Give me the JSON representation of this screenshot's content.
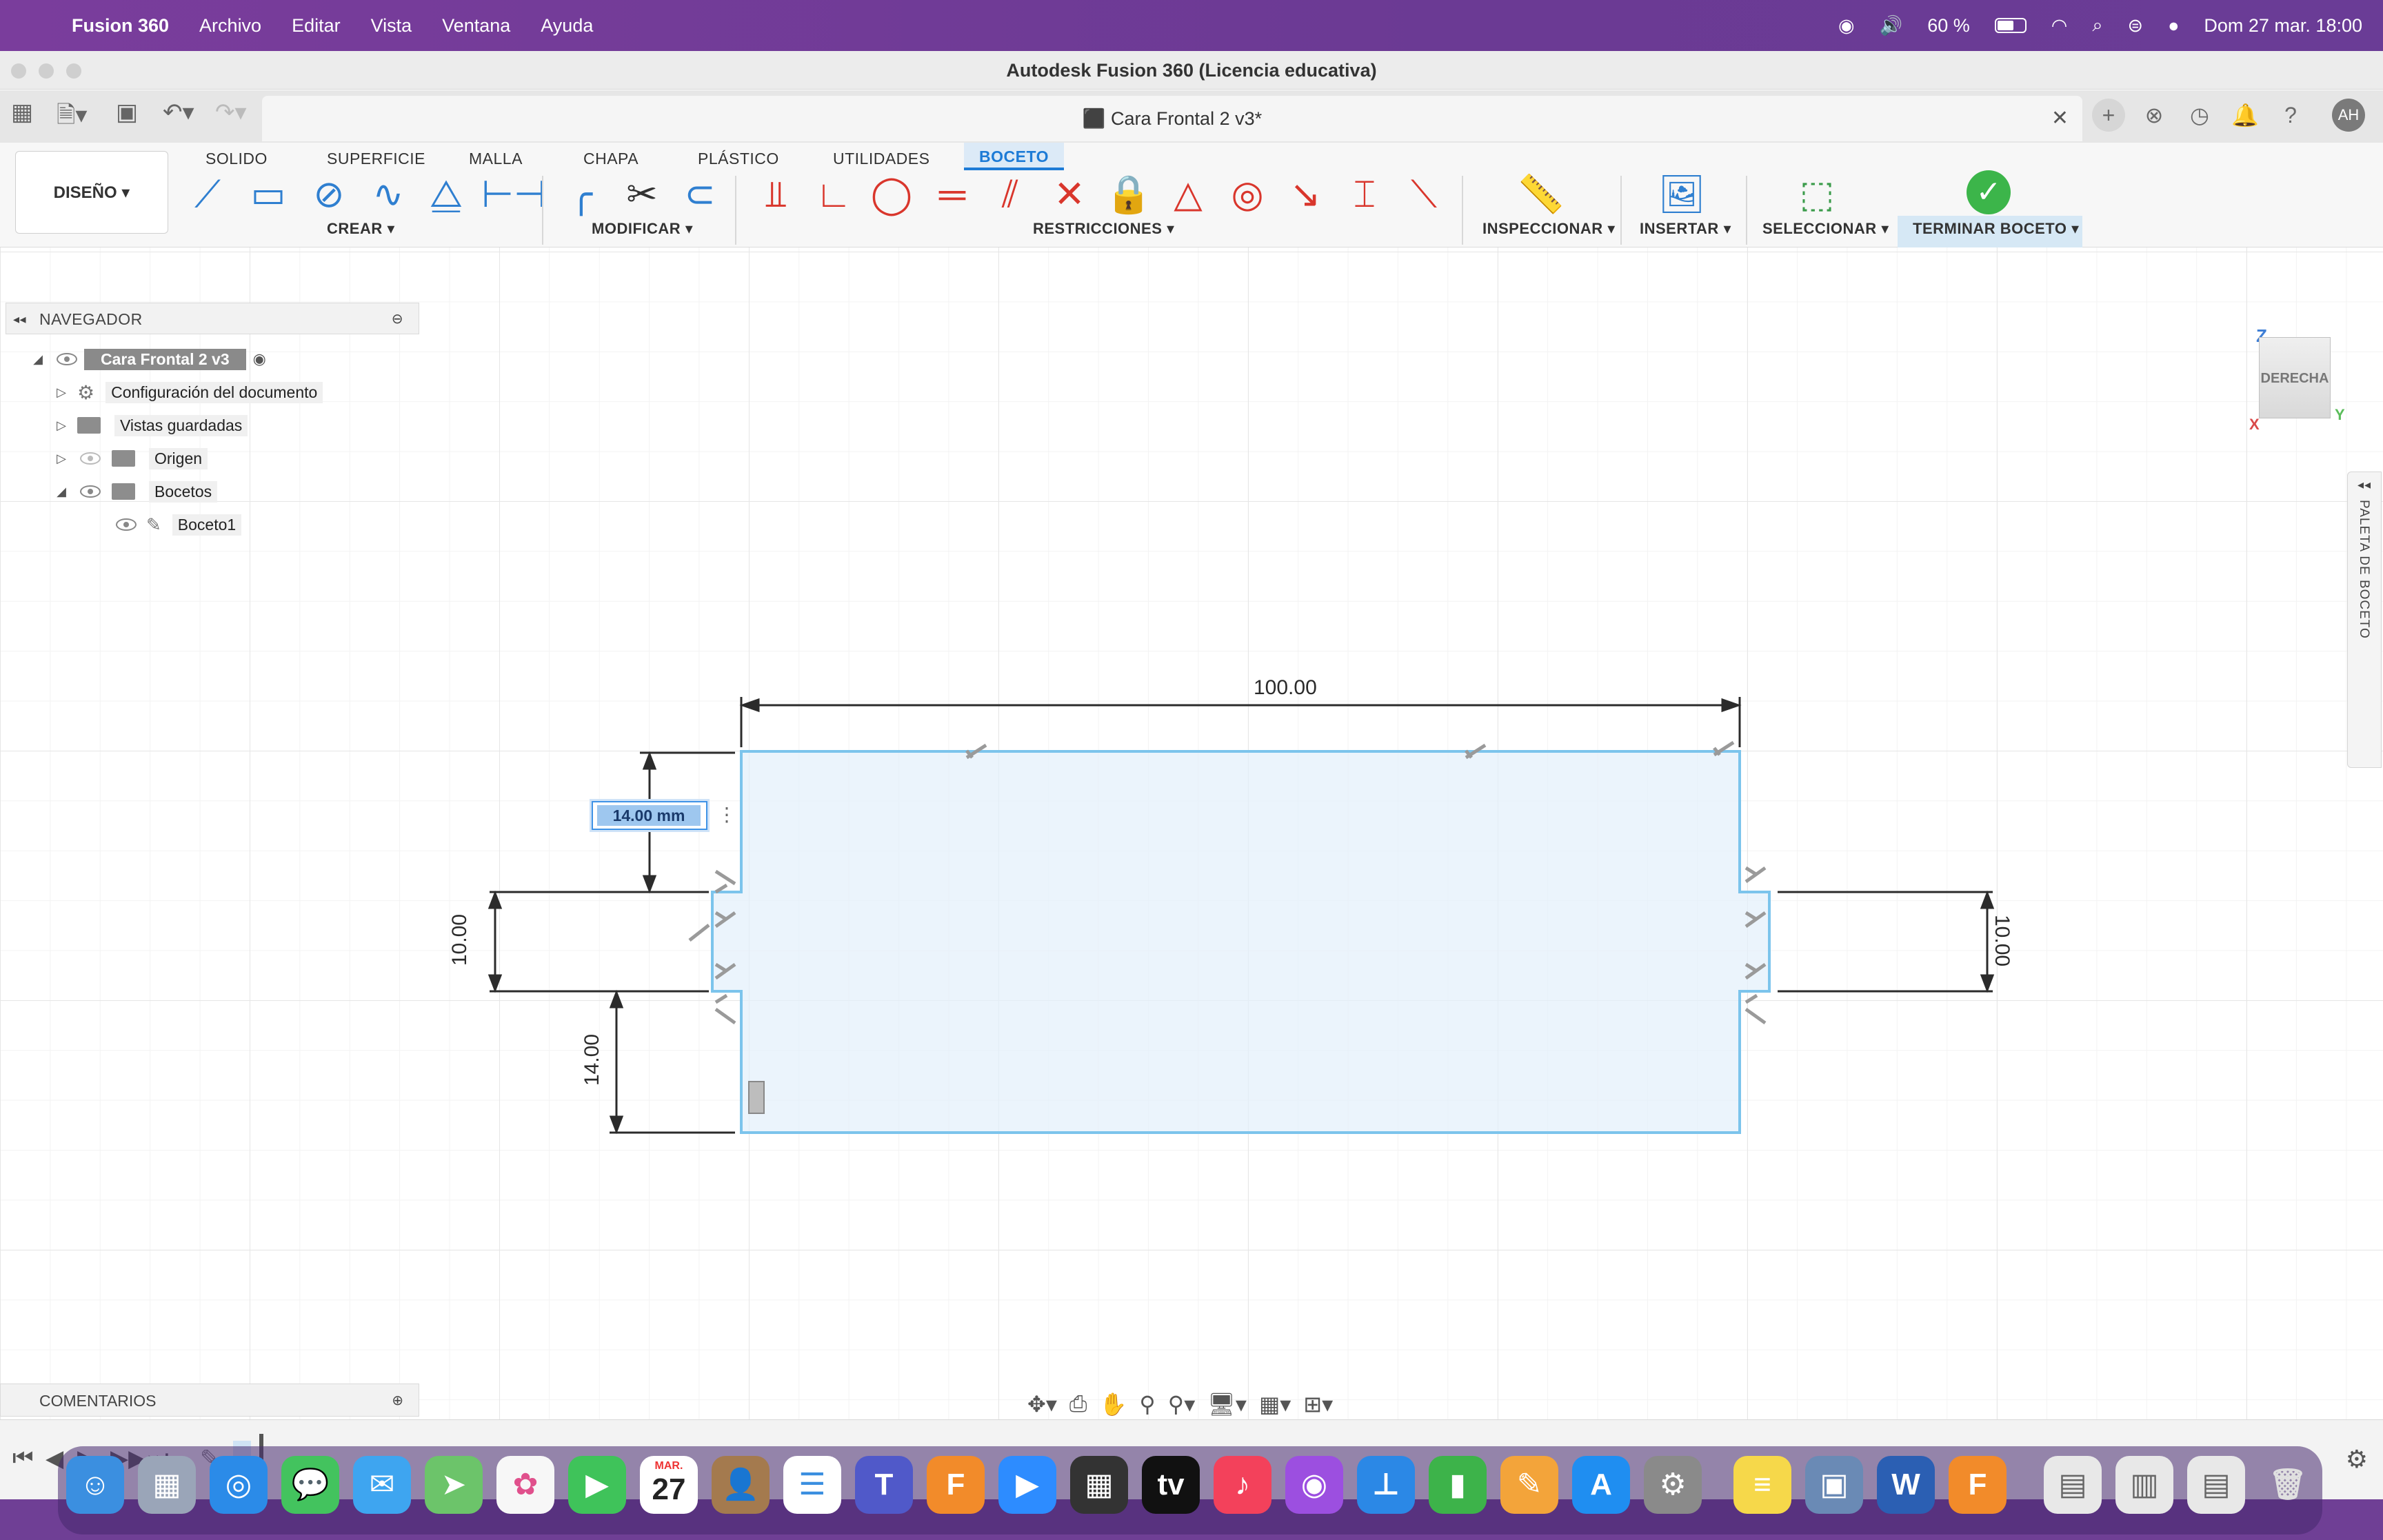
{
  "menubar": {
    "app_name": "Fusion 360",
    "items": [
      "Archivo",
      "Editar",
      "Vista",
      "Ventana",
      "Ayuda"
    ],
    "battery": "60 %",
    "battery_level": 0.6,
    "datetime": "Dom 27 mar.  18:00"
  },
  "window": {
    "title": "Autodesk Fusion 360 (Licencia educativa)",
    "doc_tab": "Cara Frontal 2 v3*",
    "user_initials": "AH"
  },
  "ribbon": {
    "workspace": "DISEÑO",
    "tabs": [
      "SOLIDO",
      "SUPERFICIE",
      "MALLA",
      "CHAPA",
      "PLÁSTICO",
      "UTILIDADES",
      "BOCETO"
    ],
    "active_tab": "BOCETO",
    "groups": {
      "crear": "CREAR",
      "modificar": "MODIFICAR",
      "restricciones": "RESTRICCIONES",
      "inspeccionar": "INSPECCIONAR",
      "insertar": "INSERTAR",
      "seleccionar": "SELECCIONAR",
      "terminar": "TERMINAR BOCETO"
    }
  },
  "browser": {
    "header": "NAVEGADOR",
    "root": "Cara Frontal 2 v3",
    "items": [
      "Configuración del documento",
      "Vistas guardadas",
      "Origen",
      "Bocetos",
      "Boceto1"
    ]
  },
  "comments": {
    "header": "COMENTARIOS"
  },
  "viewcube": {
    "face": "DERECHA",
    "axis_z": "Z",
    "axis_y": "Y",
    "axis_x": "X"
  },
  "palette": {
    "label": "PALETA DE BOCETO"
  },
  "sketch": {
    "dim_width": "100.00",
    "dim_left_height": "10.00",
    "dim_right_height": "10.00",
    "dim_bottom": "14.00",
    "dim_input_value": "14.00 mm"
  },
  "dock": {
    "calendar_month": "MAR.",
    "calendar_day": "27"
  }
}
